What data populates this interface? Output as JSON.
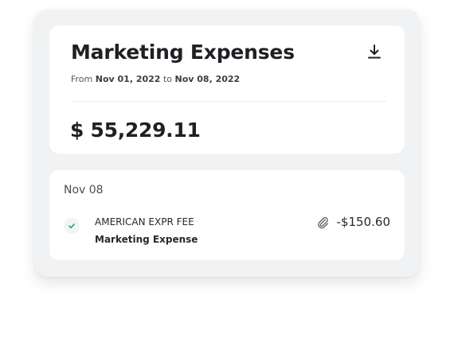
{
  "report": {
    "title": "Marketing Expenses",
    "range_prefix": "From",
    "range_start": "Nov 01, 2022",
    "range_joiner": "to",
    "range_end": "Nov 08, 2022",
    "total": "$ 55,229.11",
    "download_icon": "download-icon"
  },
  "transactions": {
    "group_date": "Nov 08",
    "items": [
      {
        "merchant": "AMERICAN EXPR FEE",
        "category": "Marketing Expense",
        "amount": "-$150.60",
        "status_icon": "check-icon",
        "attachment_icon": "paperclip-icon"
      }
    ]
  },
  "colors": {
    "check": "#22a06b",
    "text": "#1f2024",
    "muted": "#55585f",
    "panel": "#f1f2f4"
  }
}
